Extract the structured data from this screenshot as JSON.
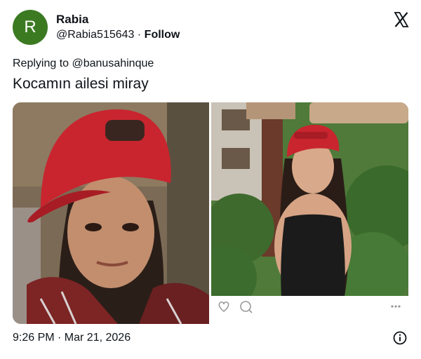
{
  "author": {
    "avatar_initial": "R",
    "name": "Rabia",
    "handle": "@Rabia515643",
    "separator": "·",
    "follow_label": "Follow"
  },
  "reply": {
    "text": "Replying to @banusahinque"
  },
  "tweet": {
    "text": "Kocamın ailesi miray"
  },
  "media": {
    "left_image": "photo-woman-red-cap-plaid-shirt",
    "right_image": "instagram-post-woman-red-cap-black-top"
  },
  "footer": {
    "timestamp": "9:26 PM · Mar 21, 2026"
  },
  "colors": {
    "avatar_bg": "#3c7a22",
    "cap_red": "#c9252f",
    "text": "#0f1419"
  },
  "icons": {
    "logo": "x-logo-icon",
    "info": "info-icon",
    "like": "heart-icon",
    "comment": "comment-icon",
    "more": "more-icon"
  }
}
